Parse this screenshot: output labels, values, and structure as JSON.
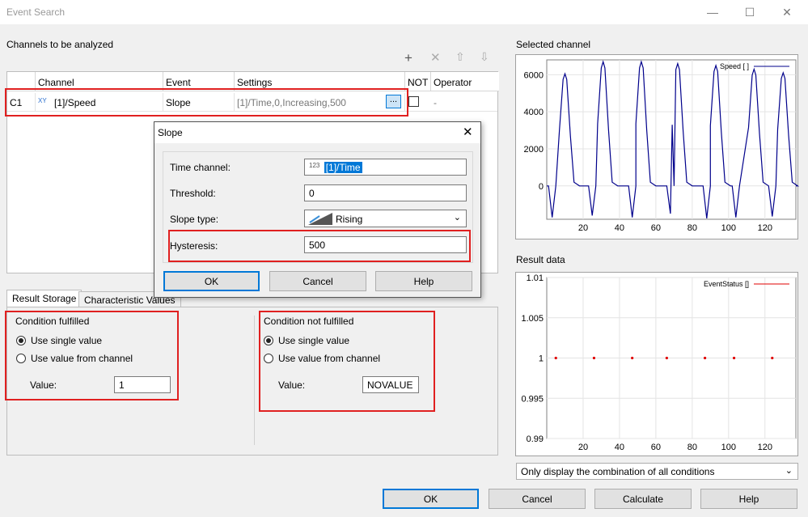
{
  "window": {
    "title": "Event Search"
  },
  "channels": {
    "section_title": "Channels to be analyzed",
    "headers": [
      "Channel",
      "Event",
      "Settings",
      "NOT",
      "Operator"
    ],
    "row": {
      "id": "C1",
      "channel": "[1]/Speed",
      "channel_icon": "XY",
      "event": "Slope",
      "settings": "[1]/Time,0,Increasing,500",
      "browse": "...",
      "operator": "-"
    }
  },
  "tabs": [
    "Result Storage",
    "Characteristic Values"
  ],
  "fulfilled": {
    "title": "Condition fulfilled",
    "opt1": "Use single value",
    "opt2": "Use value from channel",
    "value_label": "Value:",
    "value": "1"
  },
  "not_fulfilled": {
    "title": "Condition not fulfilled",
    "opt1": "Use single value",
    "opt2": "Use value from channel",
    "value_label": "Value:",
    "value": "NOVALUE"
  },
  "slope": {
    "title": "Slope",
    "time_label": "Time channel:",
    "time_icon": "123",
    "time_value": "[1]/Time",
    "threshold_label": "Threshold:",
    "threshold_value": "0",
    "slope_label": "Slope type:",
    "slope_value": "Rising",
    "hyst_label": "Hysteresis:",
    "hyst_value": "500",
    "ok": "OK",
    "cancel": "Cancel",
    "help": "Help"
  },
  "right": {
    "selected_title": "Selected channel",
    "result_title": "Result data",
    "display_option": "Only display the combination of all conditions"
  },
  "footer": {
    "ok": "OK",
    "cancel": "Cancel",
    "calculate": "Calculate",
    "help": "Help"
  },
  "chart_data": [
    {
      "type": "line",
      "legend": "Speed [ ]",
      "color": "#00008b",
      "xticks": [
        20,
        40,
        60,
        80,
        100,
        120
      ],
      "yticks": [
        0,
        2000,
        4000,
        6000
      ],
      "xlim": [
        0,
        137
      ],
      "ylim": [
        -1800,
        6800
      ],
      "peaks_x": [
        10,
        31,
        52,
        72,
        93,
        114,
        130
      ],
      "peaks_y": [
        6050,
        6700,
        6700,
        6600,
        6500,
        6300,
        6100
      ],
      "troughs_x": [
        3,
        25,
        47,
        68,
        88,
        104,
        124
      ],
      "troughs_y": [
        -1700,
        -1600,
        -1700,
        -1500,
        -1750,
        -1700,
        -1650
      ]
    },
    {
      "type": "scatter",
      "legend": "EventStatus []",
      "color": "#e00000",
      "xticks": [
        20,
        40,
        60,
        80,
        100,
        120
      ],
      "yticks": [
        "1.01",
        "1.005",
        "1",
        "0.995",
        "0.99"
      ],
      "ylim": [
        0.99,
        1.01
      ],
      "xlim": [
        0,
        137
      ],
      "x": [
        5,
        26,
        47,
        66,
        87,
        103,
        124
      ],
      "y": [
        1,
        1,
        1,
        1,
        1,
        1,
        1
      ]
    }
  ]
}
